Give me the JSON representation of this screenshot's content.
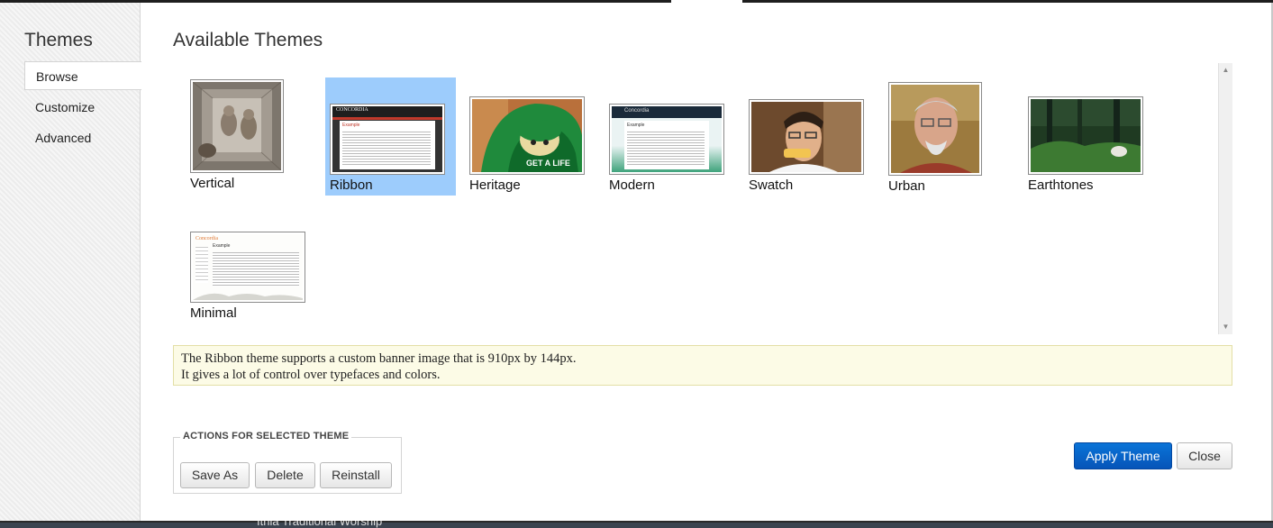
{
  "sidebar": {
    "title": "Themes",
    "items": [
      {
        "label": "Browse",
        "active": true
      },
      {
        "label": "Customize",
        "active": false
      },
      {
        "label": "Advanced",
        "active": false
      }
    ]
  },
  "main": {
    "title": "Available Themes",
    "themes": [
      {
        "name": "Vertical",
        "selected": false
      },
      {
        "name": "Ribbon",
        "selected": true
      },
      {
        "name": "Heritage",
        "selected": false
      },
      {
        "name": "Modern",
        "selected": false
      },
      {
        "name": "Swatch",
        "selected": false
      },
      {
        "name": "Urban",
        "selected": false
      },
      {
        "name": "Earthtones",
        "selected": false
      },
      {
        "name": "Minimal",
        "selected": false
      }
    ],
    "thumbnails": {
      "ribbon_site_title": "CONCORDIA",
      "ribbon_heading": "Example",
      "modern_site_title": "Concordia",
      "modern_heading": "Example",
      "minimal_site_title": "Concordia",
      "minimal_heading": "Example",
      "heritage_cap_text": "GET A LIFE"
    },
    "description": {
      "line1": "The Ribbon theme supports a custom banner image that is 910px by 144px.",
      "line2": "It gives a lot of control over typefaces and colors."
    }
  },
  "actions": {
    "legend": "ACTIONS FOR SELECTED THEME",
    "save_as": "Save As",
    "delete": "Delete",
    "reinstall": "Reinstall"
  },
  "footer": {
    "apply": "Apply Theme",
    "close": "Close"
  },
  "background": {
    "bottom_text": "Ithia         Traditional Worship"
  },
  "colors": {
    "selected_highlight": "#9dccfc",
    "primary_button": "#0654b8",
    "description_bg": "#fcfbe6"
  }
}
